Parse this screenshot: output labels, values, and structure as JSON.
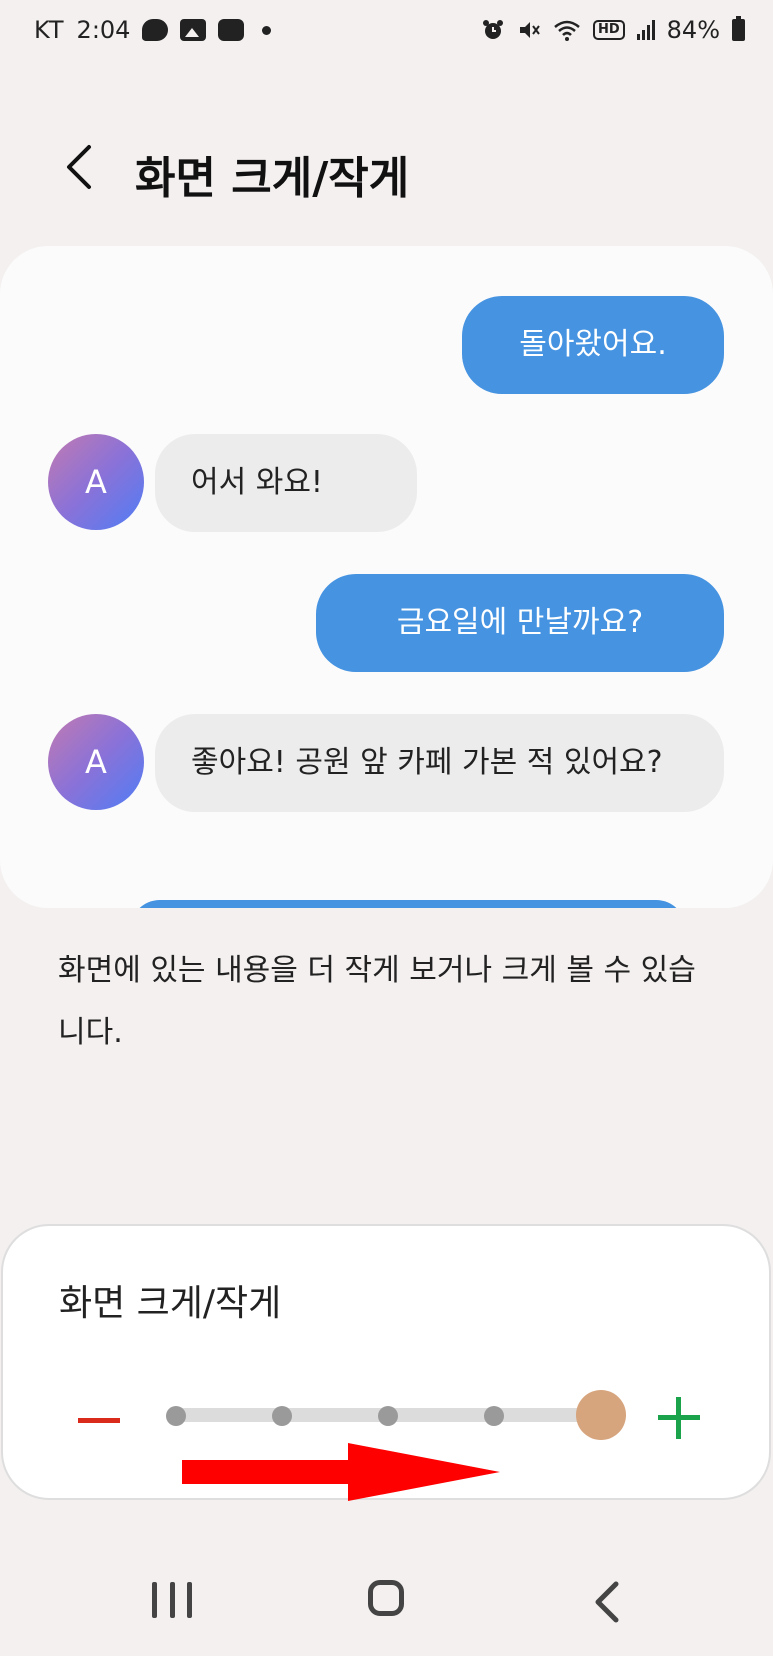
{
  "status_bar": {
    "carrier": "KT",
    "time": "2:04",
    "battery": "84%",
    "hd_label": "HD",
    "icons": [
      "kakaotalk-icon",
      "gallery-icon",
      "blog-icon",
      "notification-dot-icon",
      "alarm-icon",
      "mute-icon",
      "wifi-icon",
      "hd-icon",
      "signal-icon",
      "battery-icon"
    ]
  },
  "header": {
    "title": "화면 크게/작게"
  },
  "preview": {
    "avatar_letter": "A",
    "messages": [
      {
        "side": "out",
        "text": "돌아왔어요."
      },
      {
        "side": "in",
        "text": "어서 와요!"
      },
      {
        "side": "out",
        "text": "금요일에 만날까요?"
      },
      {
        "side": "in",
        "text": "좋아요! 공원 앞 카페 가본 적 있어요?"
      }
    ]
  },
  "description": "화면에 있는 내용을 더 작게 보거나 크게 볼 수 있습니다.",
  "zoom_panel": {
    "title": "화면 크게/작게",
    "steps": 5,
    "current_step": 5,
    "minus_color": "#d92a1c",
    "plus_color": "#1aa34a",
    "thumb_color": "#d6a47d"
  },
  "colors": {
    "accent_blue": "#4593e1",
    "annotation_red": "#ff0000"
  },
  "nav_bar": {
    "icons": [
      "recents-icon",
      "home-icon",
      "back-icon"
    ]
  }
}
